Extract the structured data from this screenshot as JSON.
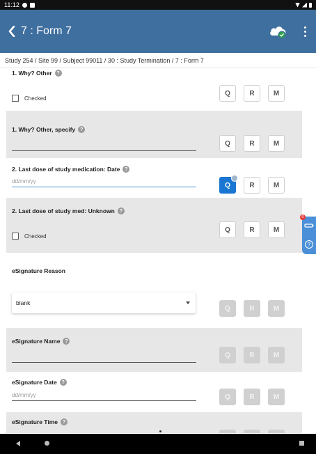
{
  "status_bar": {
    "time": "11:12"
  },
  "app_bar": {
    "title": "7 : Form 7"
  },
  "breadcrumb": "Study 254 / Site 99 / Subject 99011 / 30 : Study Termination / 7 : Form 7",
  "buttons": {
    "q": "Q",
    "r": "R",
    "m": "M"
  },
  "fields": {
    "why_other": {
      "label": "1. Why? Other",
      "checkbox_label": "Checked"
    },
    "why_other_specify": {
      "label": "1. Why? Other, specify",
      "value": ""
    },
    "last_dose_date": {
      "label": "2. Last dose of study medication: Date",
      "placeholder": "dd/mm/yy"
    },
    "last_dose_unknown": {
      "label": "2. Last dose of study med: Unknown",
      "checkbox_label": "Checked"
    },
    "esig_reason": {
      "label": "eSignature Reason",
      "selected": "blank"
    },
    "esig_name": {
      "label": "eSignature Name",
      "value": ""
    },
    "esig_date": {
      "label": "eSignature Date",
      "placeholder": "dd/mm/yy"
    },
    "esig_time": {
      "label": "eSignature Time"
    }
  },
  "side_panel": {
    "badge": "0",
    "help_icon": "?"
  },
  "colors": {
    "app_bar": "#3f6f9f",
    "query_active": "#1976d2",
    "row_grey": "#e7e7e7",
    "disabled_button": "#d0d0d0",
    "side_tab": "#4a8fd8"
  }
}
